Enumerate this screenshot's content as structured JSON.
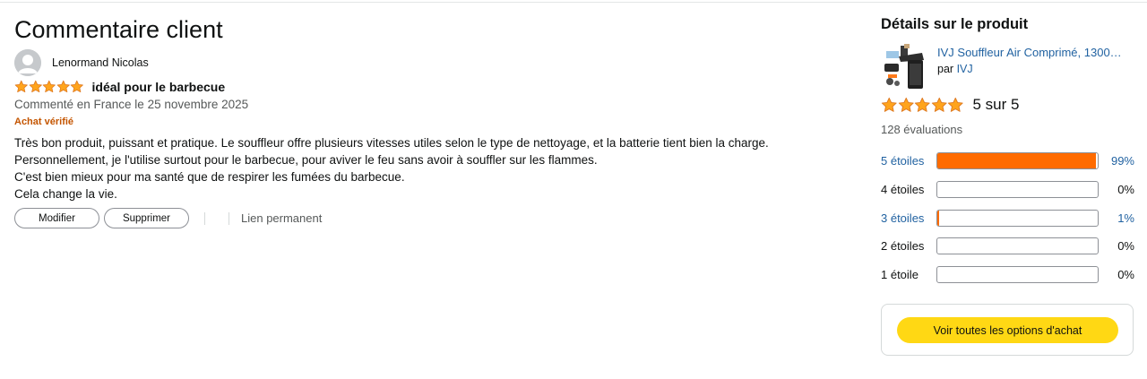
{
  "review": {
    "page_title": "Commentaire client",
    "author": "Lenormand Nicolas",
    "rating": 5,
    "rating_max": 5,
    "headline": "idéal pour le barbecue",
    "date": "Commenté en France le 25 novembre 2025",
    "verified_label": "Achat vérifié",
    "body": [
      "Très bon produit, puissant et pratique. Le souffleur offre plusieurs vitesses utiles selon le type de nettoyage, et la batterie tient bien la charge.",
      "Personnellement, je l'utilise surtout pour le barbecue, pour aviver le feu sans avoir à souffler sur les flammes.",
      "C'est bien mieux pour ma santé que de respirer les fumées du barbecue.",
      "Cela change la vie."
    ],
    "actions": {
      "modify": "Modifier",
      "delete": "Supprimer",
      "permalink": "Lien permanent"
    }
  },
  "product": {
    "section_title": "Détails sur le produit",
    "name": "IVJ Souffleur Air Comprimé, 1300…",
    "by_prefix": "par",
    "brand": "IVJ",
    "average_rating": 5,
    "average_text": "5 sur 5",
    "ratings_count": "128 évaluations",
    "histogram": [
      {
        "label": "5 étoiles",
        "percent": 99,
        "percent_text": "99%",
        "link": true
      },
      {
        "label": "4 étoiles",
        "percent": 0,
        "percent_text": "0%",
        "link": false
      },
      {
        "label": "3 étoiles",
        "percent": 1,
        "percent_text": "1%",
        "link": true
      },
      {
        "label": "2 étoiles",
        "percent": 0,
        "percent_text": "0%",
        "link": false
      },
      {
        "label": "1 étoile",
        "percent": 0,
        "percent_text": "0%",
        "link": false
      }
    ],
    "buy_options_label": "Voir toutes les options d'achat"
  },
  "colors": {
    "star": "#FFA41C",
    "star_outline": "#DE7921",
    "histogram_fill": "#FF6B00",
    "link": "#2162A1",
    "verified": "#C45500",
    "buy_button": "#FFD814"
  },
  "icons": {
    "avatar": "user-avatar-icon",
    "star": "star-icon",
    "product": "leaf-blower-product-image"
  }
}
